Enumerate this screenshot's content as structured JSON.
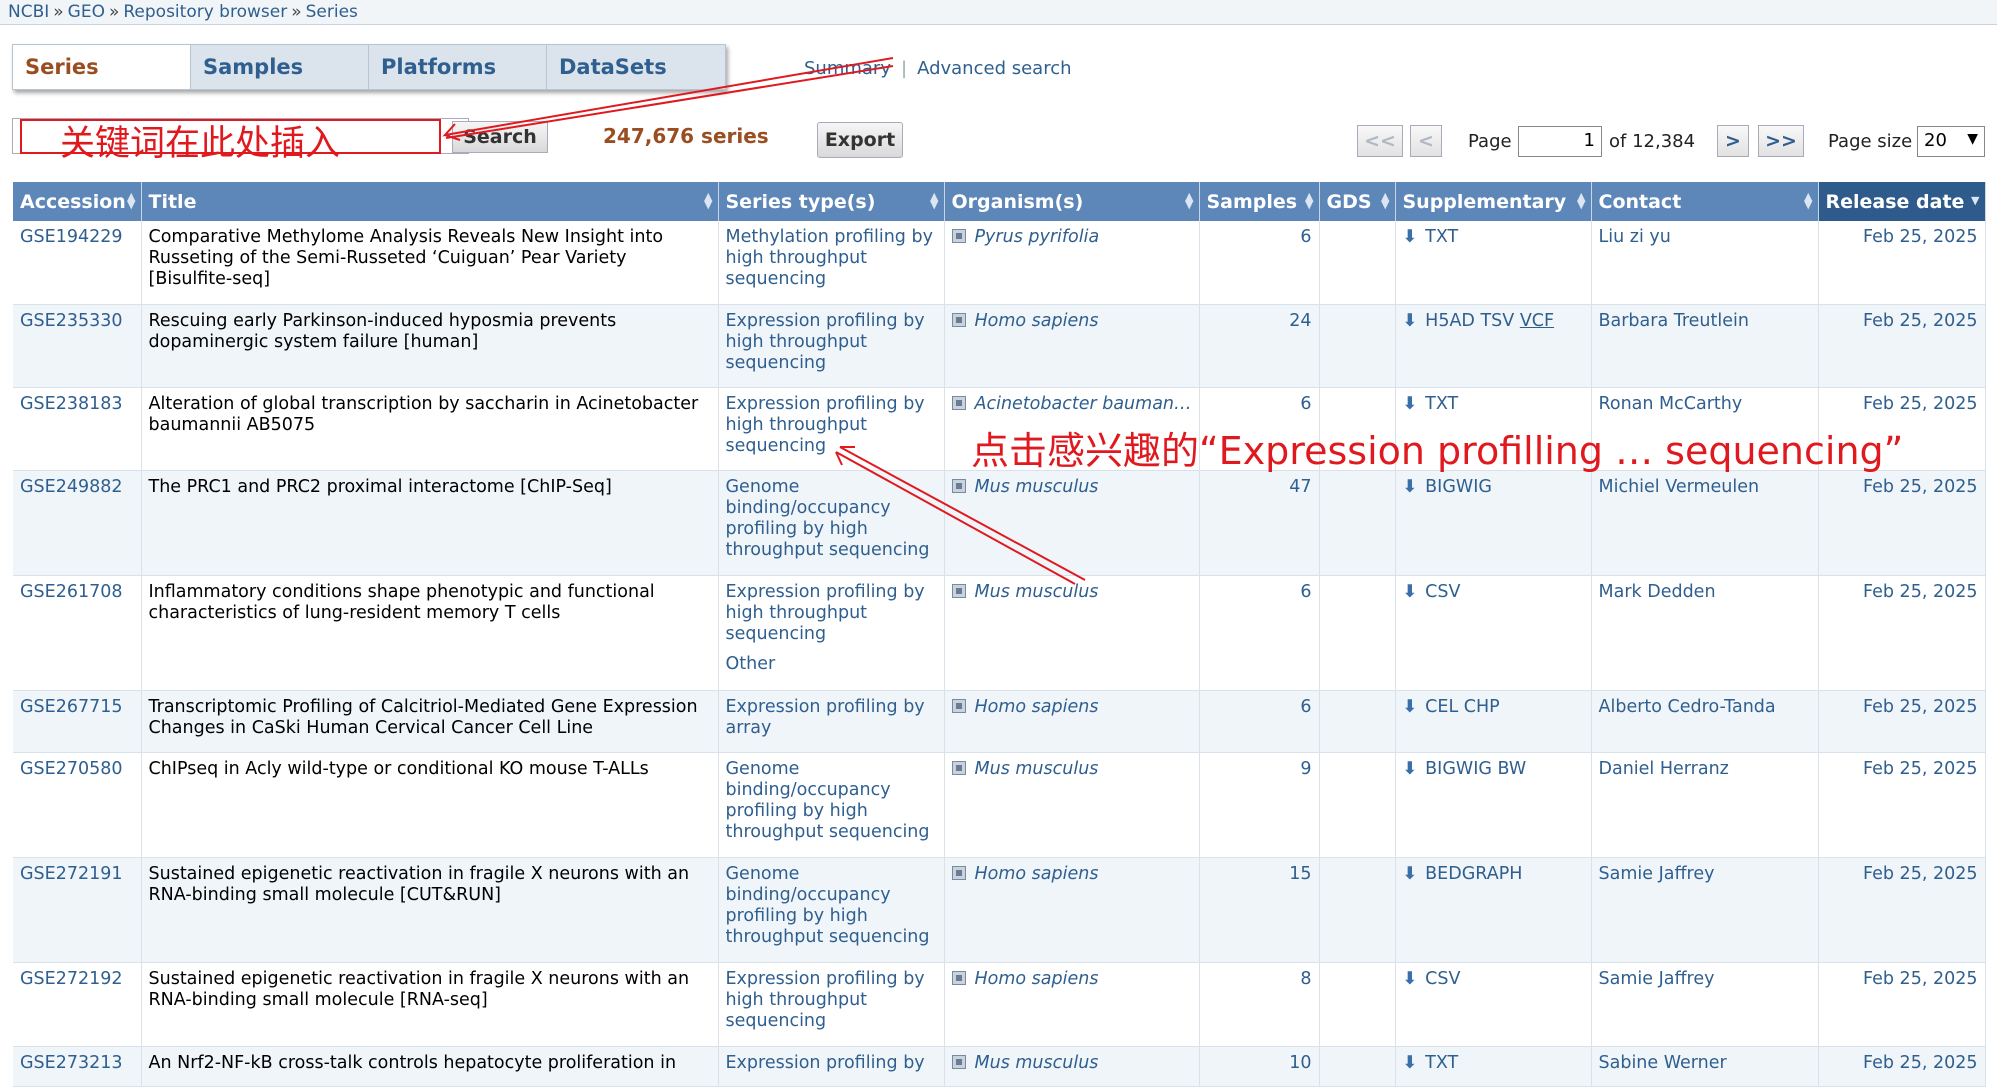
{
  "breadcrumb": [
    "NCBI",
    "GEO",
    "Repository browser",
    "Series"
  ],
  "tabs": [
    "Series",
    "Samples",
    "Platforms",
    "DataSets"
  ],
  "top_links": {
    "summary": "Summary",
    "advanced": "Advanced search"
  },
  "search": {
    "button": "Search",
    "value": ""
  },
  "series_count": "247,676 series",
  "export_label": "Export",
  "pager": {
    "first": "<<",
    "prev": "<",
    "page_label": "Page",
    "page": "1",
    "of_label": "of 12,384",
    "next": ">",
    "last": ">>",
    "size_label": "Page size",
    "size": "20"
  },
  "columns": [
    "Accession",
    "Title",
    "Series type(s)",
    "Organism(s)",
    "Samples",
    "GDS",
    "Supplementary",
    "Contact",
    "Release date"
  ],
  "rows": [
    {
      "acc": "GSE194229",
      "title": "Comparative Methylome Analysis Reveals New Insight into Russeting of the Semi-Russeted ‘Cuiguan’ Pear Variety [Bisulfite-seq]",
      "types": [
        "Methylation profiling by high throughput sequencing"
      ],
      "org": "Pyrus pyrifolia",
      "samples": "6",
      "gds": "",
      "supp": "TXT",
      "contact": "Liu zi yu",
      "date": "Feb 25, 2025"
    },
    {
      "acc": "GSE235330",
      "title": "Rescuing early Parkinson-induced hyposmia prevents dopaminergic system failure [human]",
      "types": [
        "Expression profiling by high throughput sequencing"
      ],
      "org": "Homo sapiens",
      "samples": "24",
      "gds": "",
      "supp": "H5AD TSV",
      "supp_u": "VCF",
      "contact": "Barbara Treutlein",
      "date": "Feb 25, 2025"
    },
    {
      "acc": "GSE238183",
      "title": "Alteration of global transcription by saccharin in Acinetobacter baumannii AB5075",
      "types": [
        "Expression profiling by high throughput sequencing"
      ],
      "org": "Acinetobacter bauman…",
      "samples": "6",
      "gds": "",
      "supp": "TXT",
      "contact": "Ronan McCarthy",
      "date": "Feb 25, 2025"
    },
    {
      "acc": "GSE249882",
      "title": "The PRC1 and PRC2 proximal interactome [ChIP-Seq]",
      "types": [
        "Genome binding/occupancy profiling by high throughput sequencing"
      ],
      "org": "Mus musculus",
      "samples": "47",
      "gds": "",
      "supp": "BIGWIG",
      "contact": "Michiel Vermeulen",
      "date": "Feb 25, 2025"
    },
    {
      "acc": "GSE261708",
      "title": "Inflammatory conditions shape phenotypic and functional characteristics of lung-resident memory T cells",
      "types": [
        "Expression profiling by high throughput sequencing",
        "Other"
      ],
      "org": "Mus musculus",
      "samples": "6",
      "gds": "",
      "supp": "CSV",
      "contact": "Mark Dedden",
      "date": "Feb 25, 2025"
    },
    {
      "acc": "GSE267715",
      "title": "Transcriptomic Profiling of Calcitriol-Mediated Gene Expression Changes in CaSki Human Cervical Cancer Cell Line",
      "types": [
        "Expression profiling by array"
      ],
      "org": "Homo sapiens",
      "samples": "6",
      "gds": "",
      "supp": "CEL CHP",
      "contact": "Alberto Cedro-Tanda",
      "date": "Feb 25, 2025"
    },
    {
      "acc": "GSE270580",
      "title": "ChIPseq in Acly wild-type or conditional KO mouse T-ALLs",
      "types": [
        "Genome binding/occupancy profiling by high throughput sequencing"
      ],
      "org": "Mus musculus",
      "samples": "9",
      "gds": "",
      "supp": "BIGWIG BW",
      "contact": "Daniel Herranz",
      "date": "Feb 25, 2025"
    },
    {
      "acc": "GSE272191",
      "title": "Sustained epigenetic reactivation in fragile X neurons with an RNA-binding small molecule [CUT&RUN]",
      "types": [
        "Genome binding/occupancy profiling by high throughput sequencing"
      ],
      "org": "Homo sapiens",
      "samples": "15",
      "gds": "",
      "supp": "BEDGRAPH",
      "contact": "Samie Jaffrey",
      "date": "Feb 25, 2025"
    },
    {
      "acc": "GSE272192",
      "title": "Sustained epigenetic reactivation in fragile X neurons with an RNA-binding small molecule [RNA-seq]",
      "types": [
        "Expression profiling by high throughput sequencing"
      ],
      "org": "Homo sapiens",
      "samples": "8",
      "gds": "",
      "supp": "CSV",
      "contact": "Samie Jaffrey",
      "date": "Feb 25, 2025"
    },
    {
      "acc": "GSE273213",
      "title": "An Nrf2-NF-kB cross-talk controls hepatocyte proliferation in",
      "types": [
        "Expression profiling by"
      ],
      "org": "Mus musculus",
      "samples": "10",
      "gds": "",
      "supp": "TXT",
      "contact": "Sabine Werner",
      "date": "Feb 25, 2025"
    }
  ],
  "annotations": {
    "search_hint": "关键词在此处插入",
    "click_hint": "点击感兴趣的“Expression profilling … sequencing”",
    "color": "#e0191f"
  }
}
